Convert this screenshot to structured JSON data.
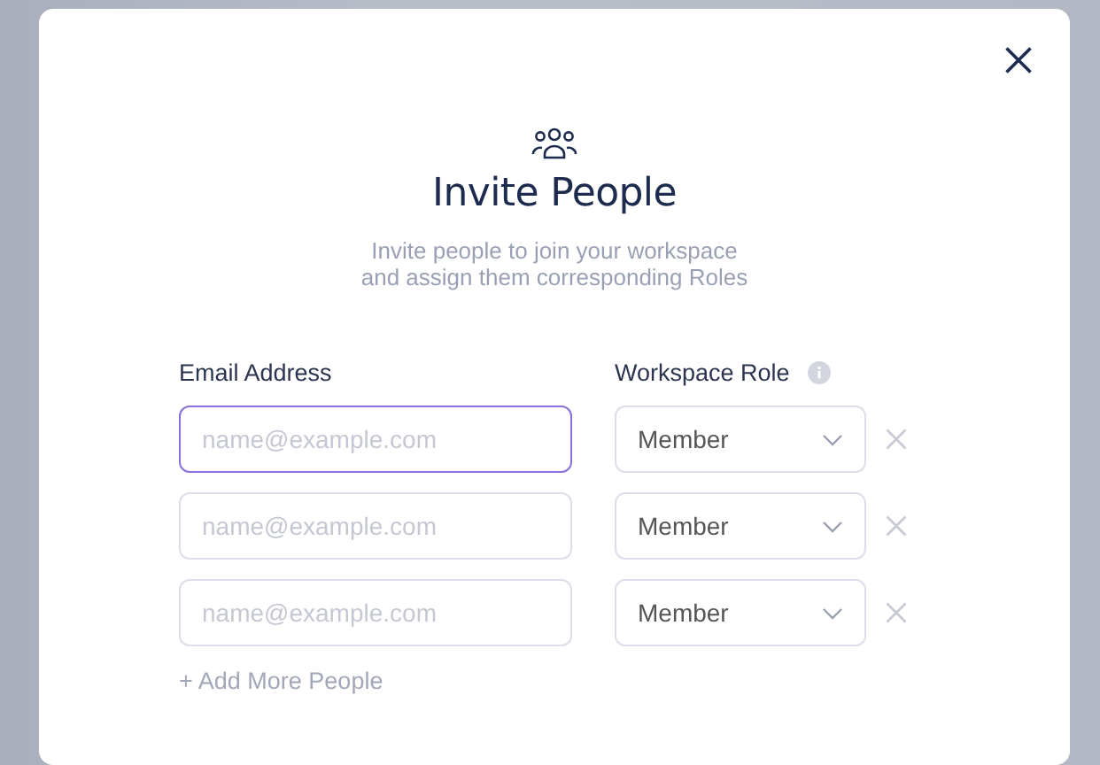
{
  "dialog": {
    "title": "Invite People",
    "subtitle_lines": [
      "Invite people to join your workspace",
      "and assign them corresponding Roles"
    ]
  },
  "form": {
    "email_label": "Email Address",
    "role_label": "Workspace Role",
    "rows": [
      {
        "placeholder": "name@example.com",
        "focused": true,
        "role": "Member"
      },
      {
        "placeholder": "name@example.com",
        "focused": false,
        "role": "Member"
      },
      {
        "placeholder": "name@example.com",
        "focused": false,
        "role": "Member"
      }
    ],
    "add_link": "+ Add More People"
  }
}
